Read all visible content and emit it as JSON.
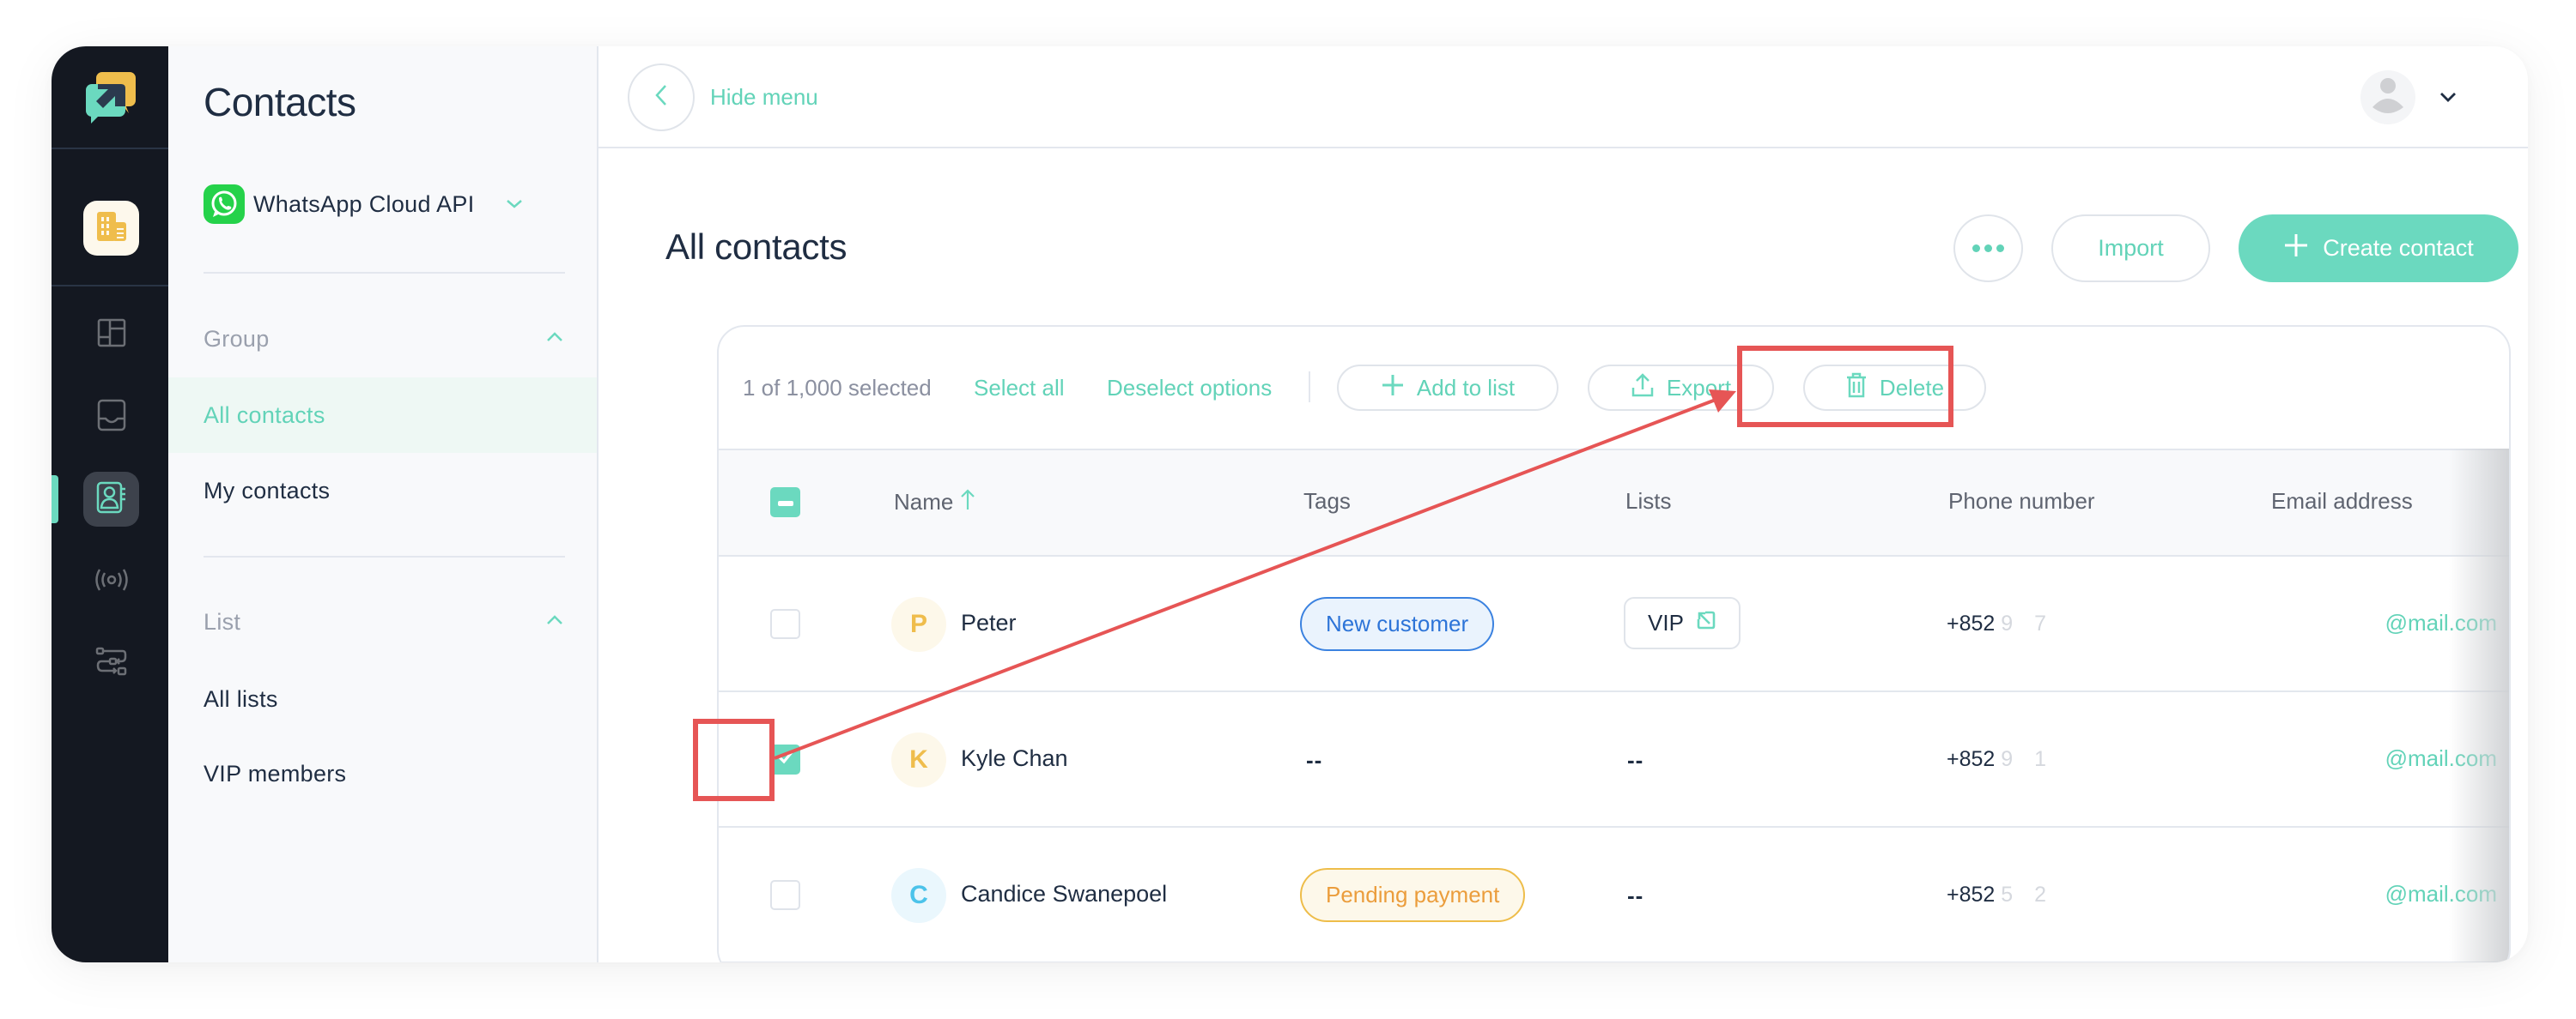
{
  "colors": {
    "accent": "#6bd9bf",
    "accent_text": "#62d3b8",
    "rail_bg": "#141821",
    "annotation": "#e65555",
    "tag_blue_bg": "#eaf3fd",
    "tag_blue_border": "#3b82e0",
    "tag_orange_bg": "#fdf8ea",
    "tag_orange_border": "#eebd4a"
  },
  "rail": {
    "items": [
      {
        "icon": "dashboard-icon"
      },
      {
        "icon": "inbox-icon"
      },
      {
        "icon": "contacts-book-icon",
        "active": true
      },
      {
        "icon": "broadcast-icon"
      },
      {
        "icon": "flow-builder-icon"
      }
    ]
  },
  "sidebar": {
    "title": "Contacts",
    "channel": {
      "label": "WhatsApp Cloud API",
      "icon": "whatsapp-icon"
    },
    "sections": [
      {
        "label": "Group",
        "items": [
          {
            "label": "All contacts",
            "active": true
          },
          {
            "label": "My contacts"
          }
        ]
      },
      {
        "label": "List",
        "items": [
          {
            "label": "All lists"
          },
          {
            "label": "VIP members"
          }
        ]
      }
    ]
  },
  "topbar": {
    "hide_menu_label": "Hide menu"
  },
  "main": {
    "title": "All contacts",
    "import_label": "Import",
    "create_label": "Create contact"
  },
  "toolbar": {
    "selected_text": "1 of 1,000 selected",
    "select_all": "Select all",
    "deselect": "Deselect options",
    "add_to_list": "Add to list",
    "export": "Export",
    "delete": "Delete"
  },
  "table": {
    "columns": [
      "Name",
      "Tags",
      "Lists",
      "Phone number",
      "Email address"
    ],
    "sort_column": "Name",
    "sort_direction": "ascending",
    "rows": [
      {
        "checked": false,
        "initial": "P",
        "name": "Peter",
        "tag": "New customer",
        "tag_style": "blue",
        "list": "VIP",
        "phone_prefix": "+852",
        "phone_rest": " 9     7",
        "email_prefix": " ",
        "email_domain": "@mail.com"
      },
      {
        "checked": true,
        "initial": "K",
        "name": "Kyle Chan",
        "tag": "--",
        "list": "--",
        "phone_prefix": "+852",
        "phone_rest": " 9     1",
        "email_prefix": " ",
        "email_domain": "@mail.com"
      },
      {
        "checked": false,
        "initial": "C",
        "name": "Candice Swanepoel",
        "tag": "Pending payment",
        "tag_style": "orange",
        "list": "--",
        "phone_prefix": "+852",
        "phone_rest": " 5     2",
        "email_prefix": " ",
        "email_domain": "@mail.com"
      }
    ]
  },
  "annotations": {
    "highlight": [
      "row-2-checkbox",
      "delete-button"
    ],
    "arrow": "from row-2-checkbox to delete-button"
  }
}
